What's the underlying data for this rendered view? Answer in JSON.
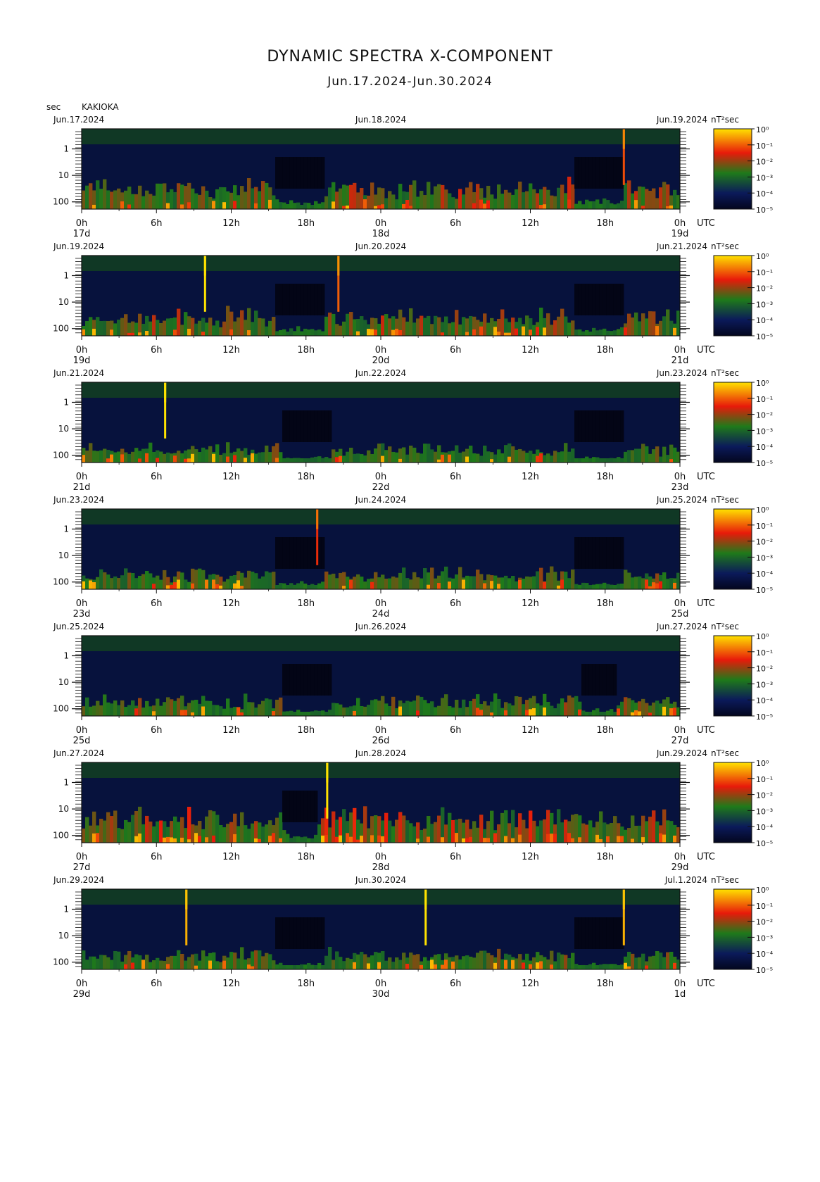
{
  "title": "DYNAMIC SPECTRA X-COMPONENT",
  "subtitle": "Jun.17.2024-Jun.30.2024",
  "unit_label": "sec",
  "station": "KAKIOKA",
  "colorbar_unit": "nT²sec",
  "colorbar_ticks": [
    "10⁰",
    "10⁻¹",
    "10⁻²",
    "10⁻³",
    "10⁻⁴",
    "10⁻⁵"
  ],
  "colors": {
    "background": "#03061e",
    "low": "#0b1a5a",
    "mid": "#1f7a1a",
    "high": "#e81a0a",
    "peak": "#ffe200"
  },
  "chart_data": {
    "type": "heatmap",
    "x_unit": "UTC hours",
    "y_label": "sec",
    "y_ticks": [
      "1",
      "10",
      "100"
    ],
    "y_scale": "log",
    "x_ticks": [
      "0h",
      "6h",
      "12h",
      "18h",
      "0h",
      "6h",
      "12h",
      "18h",
      "0h"
    ],
    "x_tick_suffix": "UTC",
    "colorscale_unit": "nT²sec",
    "colorscale_range": [
      "10⁻⁵",
      "10⁰"
    ],
    "panels": [
      {
        "date_left": "Jun.17.2024",
        "date_mid": "Jun.18.2024",
        "date_right": "Jun.19.2024",
        "days": [
          "17d",
          "18d",
          "19d"
        ],
        "spikes": [
          {
            "hour": 43.5,
            "level": 0.55
          }
        ],
        "activity": 0.62,
        "quiet_zones": [
          [
            15.5,
            19.5
          ],
          [
            39.5,
            43.5
          ]
        ]
      },
      {
        "date_left": "Jun.19.2024",
        "date_mid": "Jun.20.2024",
        "date_right": "Jun.21.2024",
        "days": [
          "19d",
          "20d",
          "21d"
        ],
        "spikes": [
          {
            "hour": 9.9,
            "level": 1.0
          },
          {
            "hour": 20.6,
            "level": 0.6
          }
        ],
        "activity": 0.58,
        "quiet_zones": [
          [
            15.5,
            19.5
          ],
          [
            39.5,
            43.5
          ]
        ]
      },
      {
        "date_left": "Jun.21.2024",
        "date_mid": "Jun.22.2024",
        "date_right": "Jun.23.2024",
        "days": [
          "21d",
          "22d",
          "23d"
        ],
        "spikes": [
          {
            "hour": 6.7,
            "level": 1.0
          }
        ],
        "activity": 0.4,
        "quiet_zones": [
          [
            16.0,
            20.0
          ],
          [
            39.5,
            43.5
          ]
        ]
      },
      {
        "date_left": "Jun.23.2024",
        "date_mid": "Jun.24.2024",
        "date_right": "Jun.25.2024",
        "days": [
          "23d",
          "24d",
          "25d"
        ],
        "spikes": [
          {
            "hour": 18.9,
            "level": 0.45
          }
        ],
        "activity": 0.45,
        "quiet_zones": [
          [
            15.5,
            19.5
          ],
          [
            39.5,
            43.5
          ]
        ]
      },
      {
        "date_left": "Jun.25.2024",
        "date_mid": "Jun.26.2024",
        "date_right": "Jun.27.2024",
        "days": [
          "25d",
          "26d",
          "27d"
        ],
        "spikes": [],
        "activity": 0.45,
        "quiet_zones": [
          [
            16.0,
            20.0
          ],
          [
            40.0,
            43.0
          ]
        ]
      },
      {
        "date_left": "Jun.27.2024",
        "date_mid": "Jun.28.2024",
        "date_right": "Jun.29.2024",
        "days": [
          "27d",
          "28d",
          "29d"
        ],
        "spikes": [
          {
            "hour": 19.7,
            "level": 1.0
          }
        ],
        "activity": 0.75,
        "quiet_zones": [
          [
            16.0,
            19.0
          ]
        ]
      },
      {
        "date_left": "Jun.29.2024",
        "date_mid": "Jun.30.2024",
        "date_right": "Jul.1.2024",
        "days": [
          "29d",
          "30d",
          "1d"
        ],
        "spikes": [
          {
            "hour": 8.4,
            "level": 0.85
          },
          {
            "hour": 27.6,
            "level": 1.0
          },
          {
            "hour": 43.5,
            "level": 0.85
          }
        ],
        "activity": 0.45,
        "quiet_zones": [
          [
            15.5,
            19.5
          ],
          [
            39.5,
            43.5
          ]
        ]
      }
    ]
  }
}
